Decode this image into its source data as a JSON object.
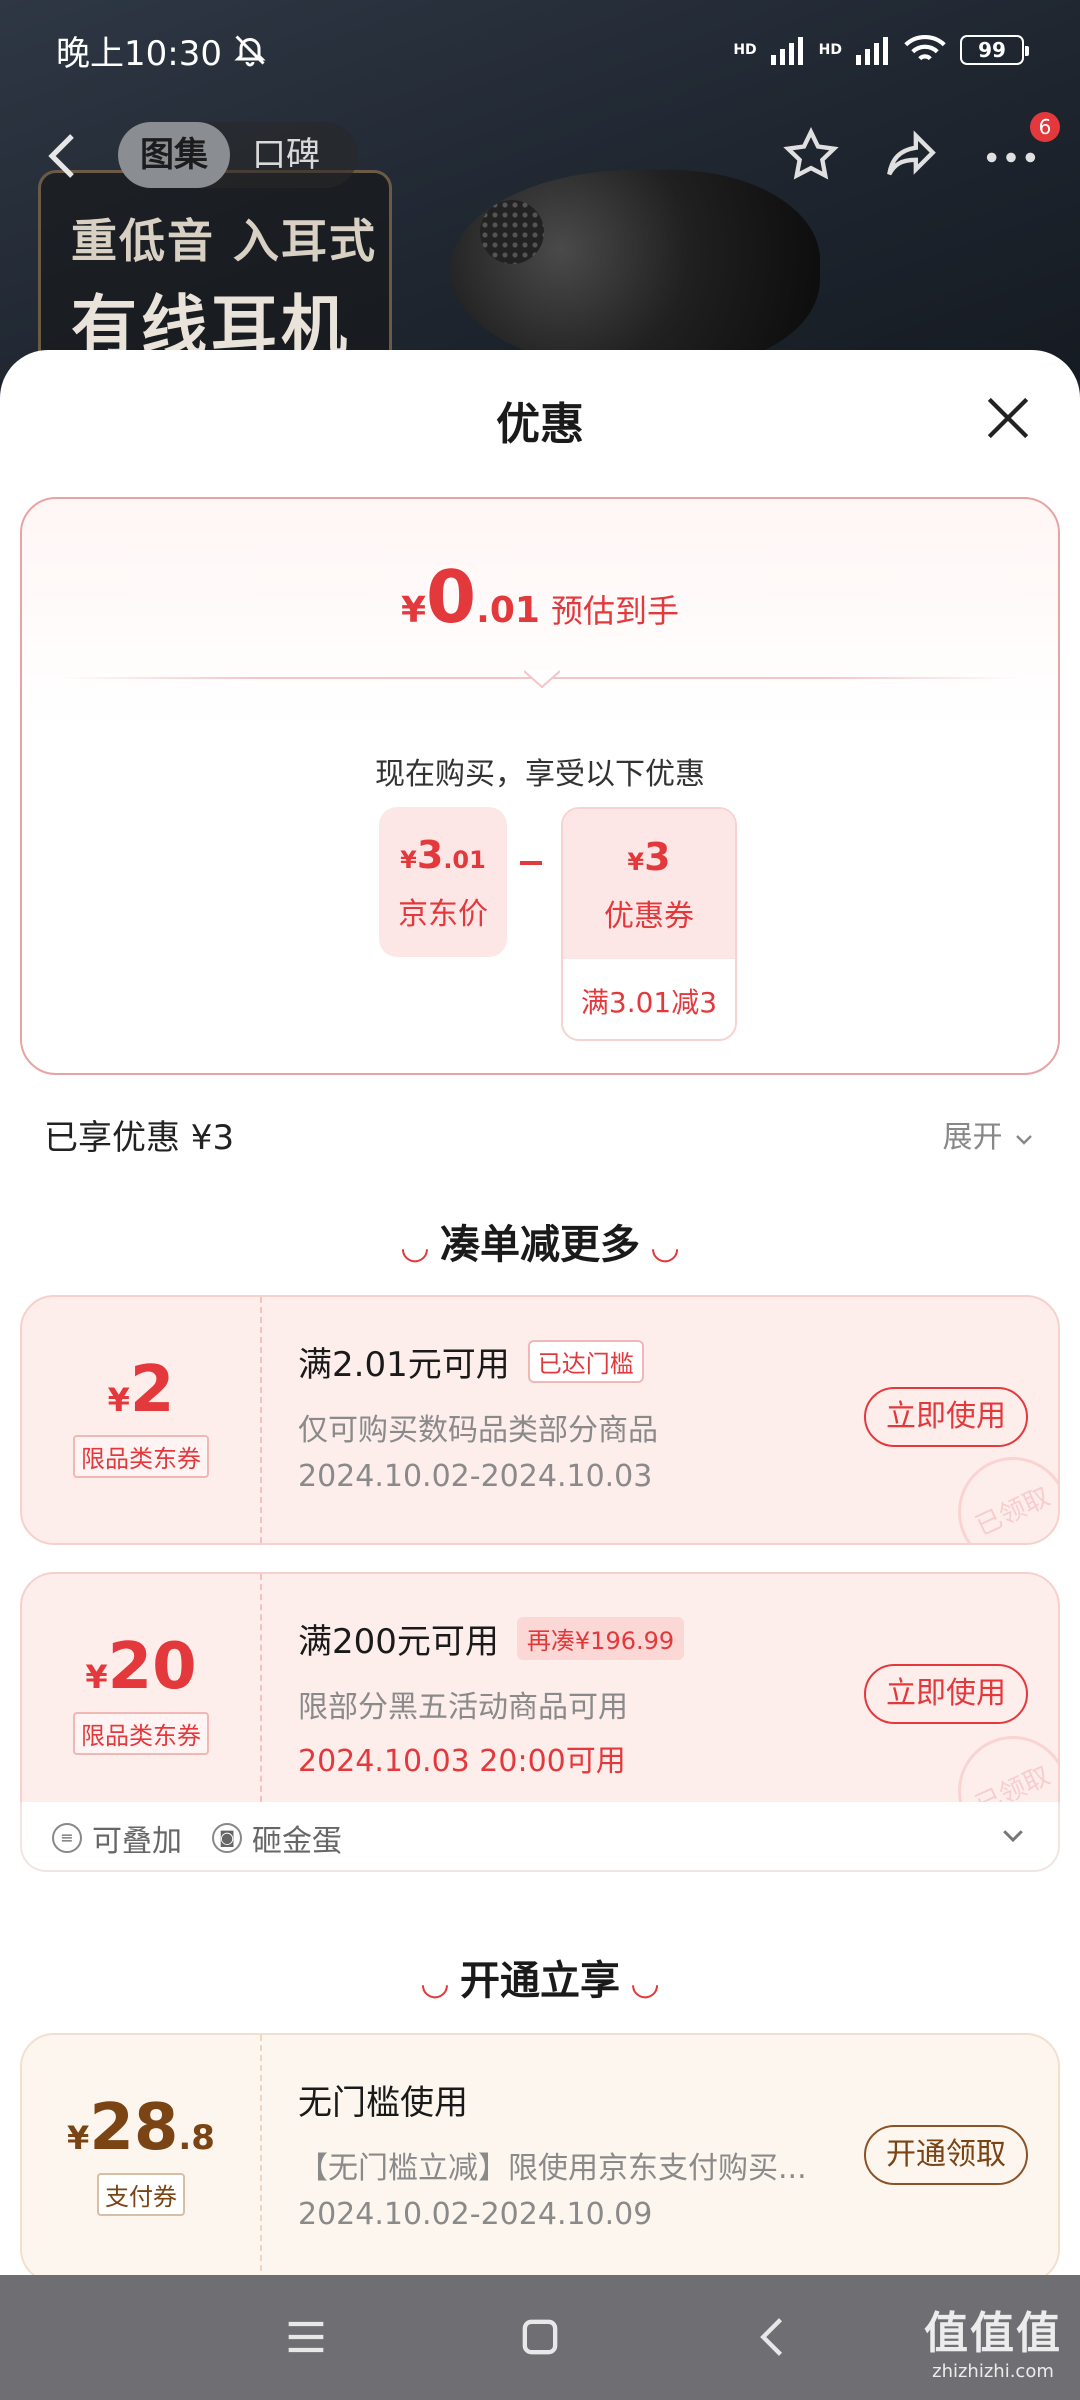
{
  "status_bar": {
    "time": "晚上10:30",
    "battery": "99",
    "signal_labels": [
      "HD",
      "HD"
    ]
  },
  "nav": {
    "tabs": [
      {
        "label": "图集",
        "active": true
      },
      {
        "label": "口碑",
        "active": false
      }
    ],
    "badge_count": "6"
  },
  "hero": {
    "line1": "重低音 入耳式",
    "line2": "有线耳机"
  },
  "sheet": {
    "title": "优惠",
    "estimate": {
      "currency": "¥",
      "integer": "0",
      "decimal": ".01",
      "label": "预估到手"
    },
    "now_text": "现在购买，享受以下优惠",
    "jd_price": {
      "currency": "¥",
      "integer": "3",
      "decimal": ".01",
      "label": "京东价"
    },
    "coupon_price": {
      "currency": "¥",
      "amount": "3",
      "label": "优惠券",
      "condition": "满3.01减3"
    },
    "enjoyed": "已享优惠 ¥3",
    "expand": "展开"
  },
  "section_more": {
    "title": "凑单减更多"
  },
  "coupons": [
    {
      "currency": "¥",
      "amount": "2",
      "decimal": "",
      "tag": "限品类东券",
      "title": "满2.01元可用",
      "flag": "已达门槛",
      "desc": "仅可购买数码品类部分商品",
      "date": "2024.10.02-2024.10.03",
      "button": "立即使用",
      "stamp": "已领取"
    },
    {
      "currency": "¥",
      "amount": "20",
      "decimal": "",
      "tag": "限品类东券",
      "title": "满200元可用",
      "flag": "再凑¥196.99",
      "desc": "限部分黑五活动商品可用",
      "date": "2024.10.03 20:00可用",
      "button": "立即使用",
      "stamp": "已领取"
    }
  ],
  "coupon_footer": {
    "stackable": "可叠加",
    "golden_egg": "砸金蛋"
  },
  "section_open": {
    "title": "开通立享"
  },
  "pay_coupon": {
    "currency": "¥",
    "amount": "28",
    "decimal": ".8",
    "tag": "支付券",
    "title": "无门槛使用",
    "desc": "【无门槛立减】限使用京东支付购买...",
    "date": "2024.10.02-2024.10.09",
    "button": "开通领取"
  },
  "watermark": {
    "main": "值值值",
    "sub": "zhizhizhi.com"
  },
  "colors": {
    "accent": "#e4393c",
    "gold": "#7a4414",
    "coupon_bg": "#fdeeec"
  }
}
